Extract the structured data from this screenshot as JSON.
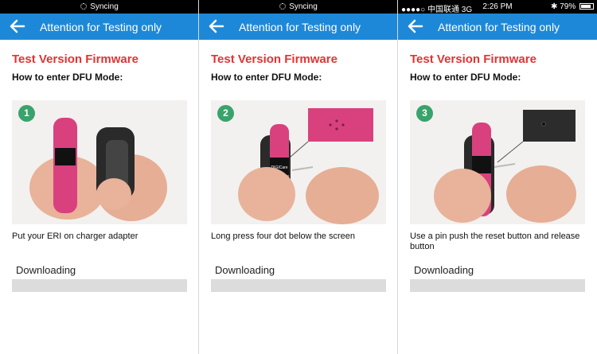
{
  "panels": [
    {
      "status": {
        "type": "syncing",
        "text": "Syncing"
      },
      "nav_title": "Attention for Testing only",
      "firmware_title": "Test Version Firmware",
      "subtitle": "How to enter DFU Mode:",
      "step": "1",
      "caption": "Put your ERI on charger adapter",
      "download_label": "Downloading",
      "download_progress": 0
    },
    {
      "status": {
        "type": "syncing",
        "text": "Syncing"
      },
      "nav_title": "Attention for Testing only",
      "firmware_title": "Test Version Firmware",
      "subtitle": "How to enter DFU Mode:",
      "step": "2",
      "caption": "Long press four dot below the screen",
      "download_label": "Downloading",
      "download_progress": 0
    },
    {
      "status": {
        "type": "carrier",
        "carrier": "●●●●○ 中国联通  3G",
        "time": "2:26 PM",
        "battery": "79%"
      },
      "nav_title": "Attention for Testing only",
      "firmware_title": "Test Version Firmware",
      "subtitle": "How to enter DFU Mode:",
      "step": "3",
      "caption": "Use a pin push the reset button and release button",
      "download_label": "Downloading",
      "download_progress": 0
    }
  ],
  "colors": {
    "nav_bar": "#1e88d8",
    "firmware_title": "#e53232",
    "step_badge": "#3aa26b",
    "progress_track": "#dcdcdc",
    "band_pink": "#d9417e"
  },
  "icons": {
    "back": "arrow-left-icon",
    "syncing": "spinner-icon",
    "bluetooth": "bluetooth-icon",
    "battery": "battery-icon"
  },
  "photo_texts": {
    "device_brand": "DIGICare"
  }
}
